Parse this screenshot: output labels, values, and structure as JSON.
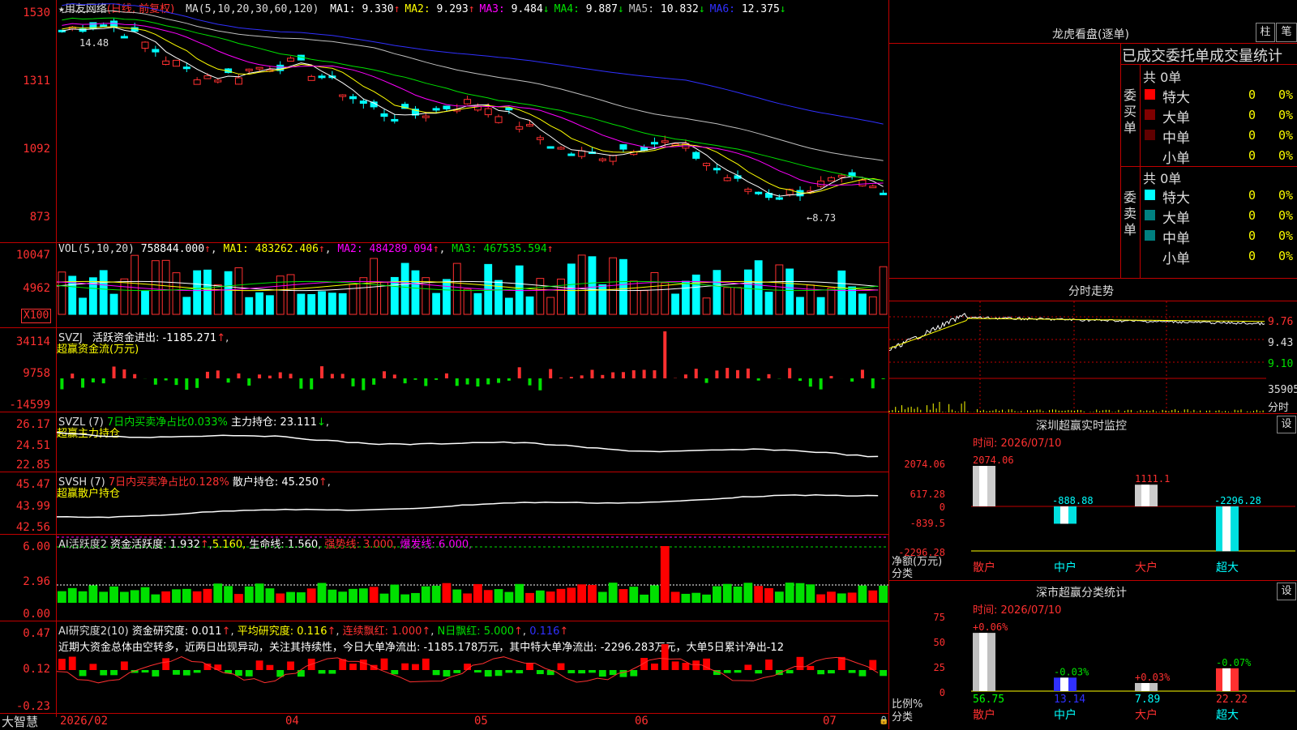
{
  "stock": {
    "star": "★",
    "name": "用友网络",
    "period": "(日线, 前复权)"
  },
  "price_pane": {
    "ma_label": "MA(5,10,20,30,60,120)",
    "ma": [
      {
        "label": "MA1:",
        "value": "9.330",
        "arrow": "↑",
        "color": "#ffffff"
      },
      {
        "label": "MA2:",
        "value": "9.293",
        "arrow": "↑",
        "color": "#ffff00"
      },
      {
        "label": "MA3:",
        "value": "9.484",
        "arrow": "↓",
        "color": "#ff00ff"
      },
      {
        "label": "MA4:",
        "value": "9.887",
        "arrow": "↓",
        "color": "#00e000"
      },
      {
        "label": "MA5:",
        "value": "10.832",
        "arrow": "↓",
        "color": "#c0c0c0"
      },
      {
        "label": "MA6:",
        "value": "12.375",
        "arrow": "↓",
        "color": "#3030ff"
      }
    ],
    "y_ticks": [
      "1530",
      "1311",
      "1092",
      "873"
    ],
    "high_label": "14.48",
    "low_label": "←8.73"
  },
  "vol_pane": {
    "label": "VOL(5,10,20)",
    "value": "758844.000",
    "ma1": "MA1: 483262.406",
    "ma2": "MA2: 484289.094",
    "ma3": "MA3: 467535.594",
    "y_ticks": [
      "10047",
      "4962"
    ],
    "unit": "X100"
  },
  "svzj_pane": {
    "label": "SVZJ",
    "text": "活跃资金进出: -1185.271",
    "sub": "超赢资金流(万元)",
    "y_ticks": [
      "34114",
      "9758",
      "-14599"
    ]
  },
  "svzl_pane": {
    "label": "SVZL (7)",
    "text1": "7日内买卖净占比0.033%",
    "text2": "主力持仓: 23.111",
    "sub": "超赢主力持仓",
    "y_ticks": [
      "26.17",
      "24.51",
      "22.85"
    ]
  },
  "svsh_pane": {
    "label": "SVSH (7)",
    "text1": "7日内买卖净占比0.128%",
    "text2": "散户持仓: 45.250",
    "sub": "超赢散户持仓",
    "y_ticks": [
      "45.47",
      "43.99",
      "42.56"
    ]
  },
  "ai2_pane": {
    "label": "AI活跃度2",
    "text1": "资金活跃度: 1.932",
    "text2": "5.160,",
    "text3": "生命线: 1.560,",
    "text4": "强势线: 3.000,",
    "text5": "爆发线: 6.000,",
    "y_ticks": [
      "6.00",
      "2.96",
      "0.00"
    ]
  },
  "air_pane": {
    "label": "AI研究度2(10)",
    "text1": "资金研究度: 0.011",
    "text2": "平均研究度: 0.116",
    "text3": "连续飘红: 1.000",
    "text4": "N日飘红: 5.000",
    "text5": "0.116",
    "comment": "近期大资金总体由空转多，近两日出现异动，关注其持续性，今日大单净流出: -1185.178万元，其中特大单净流出: -2296.283万元，大单5日累计净出-12",
    "y_ticks": [
      "0.47",
      "0.12",
      "-0.23"
    ]
  },
  "x_axis": {
    "labels": [
      "2026/02",
      "04",
      "05",
      "06",
      "07"
    ],
    "brand": "大智慧"
  },
  "dragon": {
    "title": "龙虎看盘(逐单)",
    "btn1": "柱",
    "btn2": "笔",
    "tabs": "已成交委托单成交量统计",
    "buy": {
      "side": "委买单",
      "total": "共 0单",
      "rows": [
        {
          "label": "特大",
          "n": "0",
          "pct": "0%",
          "color": "#ff0000"
        },
        {
          "label": "大单",
          "n": "0",
          "pct": "0%",
          "color": "#800000"
        },
        {
          "label": "中单",
          "n": "0",
          "pct": "0%",
          "color": "#600000"
        },
        {
          "label": "小单",
          "n": "0",
          "pct": "0%",
          "color": "#000000"
        }
      ]
    },
    "sell": {
      "side": "委卖单",
      "total": "共 0单",
      "rows": [
        {
          "label": "特大",
          "n": "0",
          "pct": "0%",
          "color": "#00ffff"
        },
        {
          "label": "大单",
          "n": "0",
          "pct": "0%",
          "color": "#008080"
        },
        {
          "label": "中单",
          "n": "0",
          "pct": "0%",
          "color": "#008080"
        },
        {
          "label": "小单",
          "n": "0",
          "pct": "0%",
          "color": "#000000"
        }
      ]
    }
  },
  "intraday": {
    "title": "分时走势",
    "p1": "9.76",
    "p2": "9.43",
    "p3": "9.10",
    "vol": "35905",
    "vol_unit": "分时"
  },
  "sz_monitor": {
    "title": "深圳超赢实时监控",
    "btn": "设",
    "time": "时间: 2026/07/10",
    "y_ticks": [
      "2074.06",
      "617.28",
      "0",
      "-839.5",
      "-2296.28"
    ],
    "label1": "净额(万元)",
    "label2": "分类",
    "bars": [
      {
        "cat": "散户",
        "value": 2074.06,
        "label": "2074.06"
      },
      {
        "cat": "中户",
        "value": -888.88,
        "label": "-888.88"
      },
      {
        "cat": "大户",
        "value": 1111.1,
        "label": "1111.1"
      },
      {
        "cat": "超大",
        "value": -2296.28,
        "label": "-2296.28"
      }
    ]
  },
  "sz_class": {
    "title": "深市超赢分类统计",
    "btn": "设",
    "time": "时间: 2026/07/10",
    "y_ticks": [
      "75",
      "50",
      "25",
      "0"
    ],
    "label1": "比例%",
    "label2": "分类",
    "bars": [
      {
        "cat": "散户",
        "value": 56.75,
        "label": "56.75",
        "delta": "+0.06%"
      },
      {
        "cat": "中户",
        "value": 13.14,
        "label": "13.14",
        "delta": "-0.03%"
      },
      {
        "cat": "大户",
        "value": 7.89,
        "label": "7.89",
        "delta": "+0.03%"
      },
      {
        "cat": "超大",
        "value": 22.22,
        "label": "22.22",
        "delta": "-0.07%"
      }
    ]
  }
}
